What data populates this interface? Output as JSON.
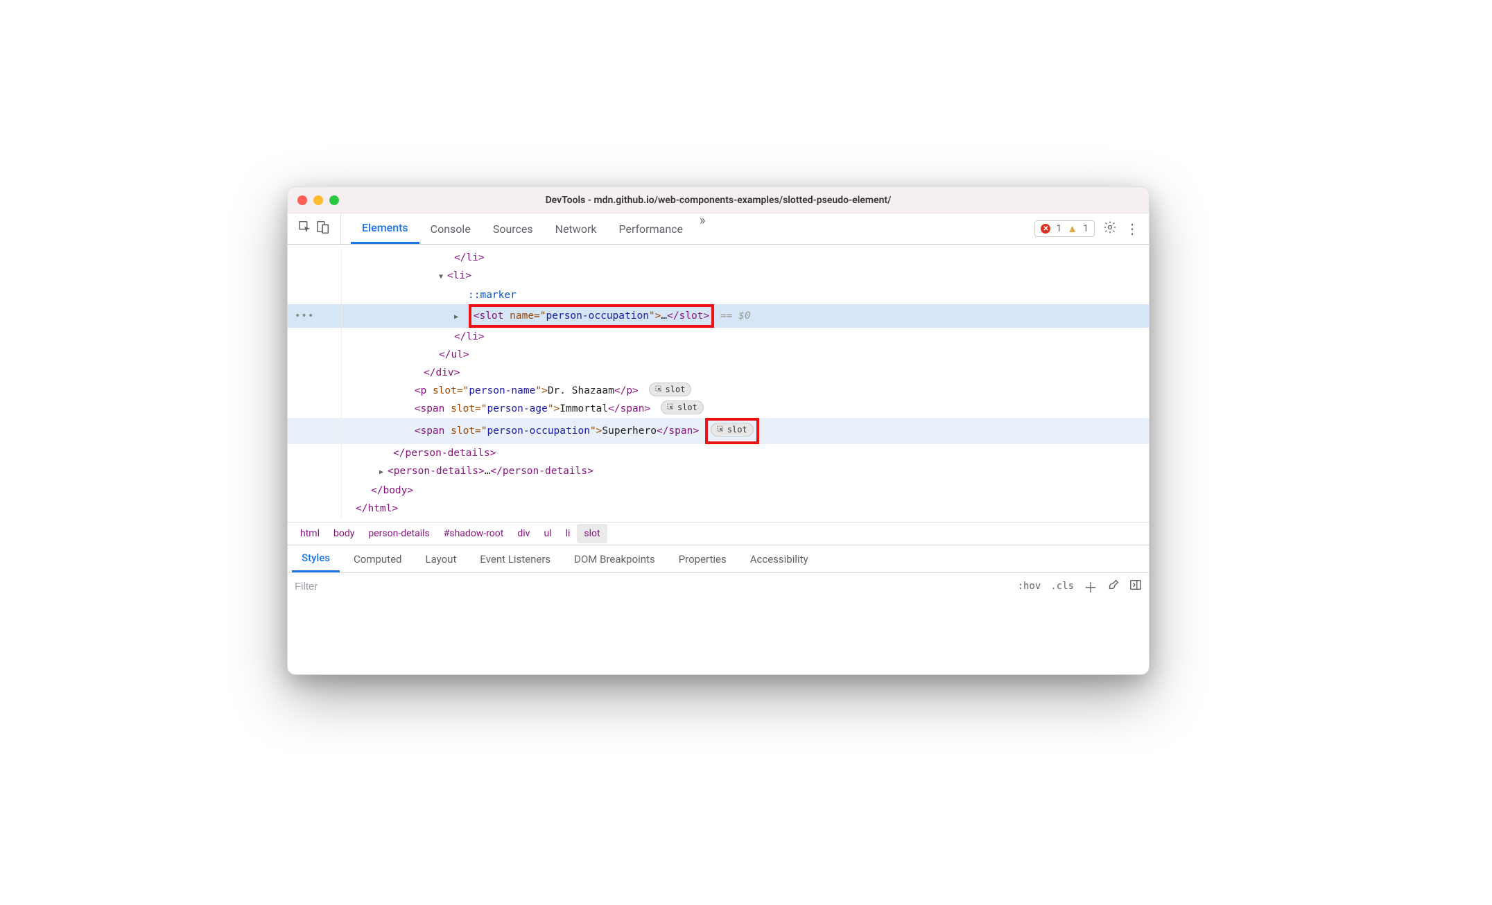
{
  "title": "DevTools - mdn.github.io/web-components-examples/slotted-pseudo-element/",
  "tabs": {
    "elements": "Elements",
    "console": "Console",
    "sources": "Sources",
    "network": "Network",
    "performance": "Performance"
  },
  "badges": {
    "errors": "1",
    "warnings": "1"
  },
  "tree": {
    "li_close": "</li>",
    "li_open": "<li>",
    "marker": "::marker",
    "slot_tag_open_a": "<slot",
    "slot_attr": "name",
    "slot_attr_eq": "=\"",
    "slot_val": "person-occupation",
    "slot_attr_close": "\">",
    "slot_ellipsis": "…",
    "slot_close": "</slot>",
    "eq_dollar": " == $0",
    "li_close2": "</li>",
    "ul_close": "</ul>",
    "div_close": "</div>",
    "p_open": "<p",
    "p_slot_attr": "slot",
    "p_slot_val": "person-name",
    "p_text": "Dr. Shazaam",
    "p_close": "</p>",
    "s1_open": "<span",
    "s1_val": "person-age",
    "s1_text": "Immortal",
    "s1_close": "</span>",
    "s2_open": "<span",
    "s2_val": "person-occupation",
    "s2_text": "Superhero",
    "s2_close": "</span>",
    "pd_close": "</person-details>",
    "pd2_open": "<person-details>",
    "pd2_ellipsis": "…",
    "pd2_close": "</person-details>",
    "body_close": "</body>",
    "html_close": "</html>",
    "slot_badge": "slot"
  },
  "crumbs": {
    "html": "html",
    "body": "body",
    "pd": "person-details",
    "shadow": "#shadow-root",
    "div": "div",
    "ul": "ul",
    "li": "li",
    "slot": "slot"
  },
  "subtabs": {
    "styles": "Styles",
    "computed": "Computed",
    "layout": "Layout",
    "events": "Event Listeners",
    "dombp": "DOM Breakpoints",
    "props": "Properties",
    "a11y": "Accessibility"
  },
  "filter": {
    "placeholder": "Filter",
    "hov": ":hov",
    "cls": ".cls"
  }
}
